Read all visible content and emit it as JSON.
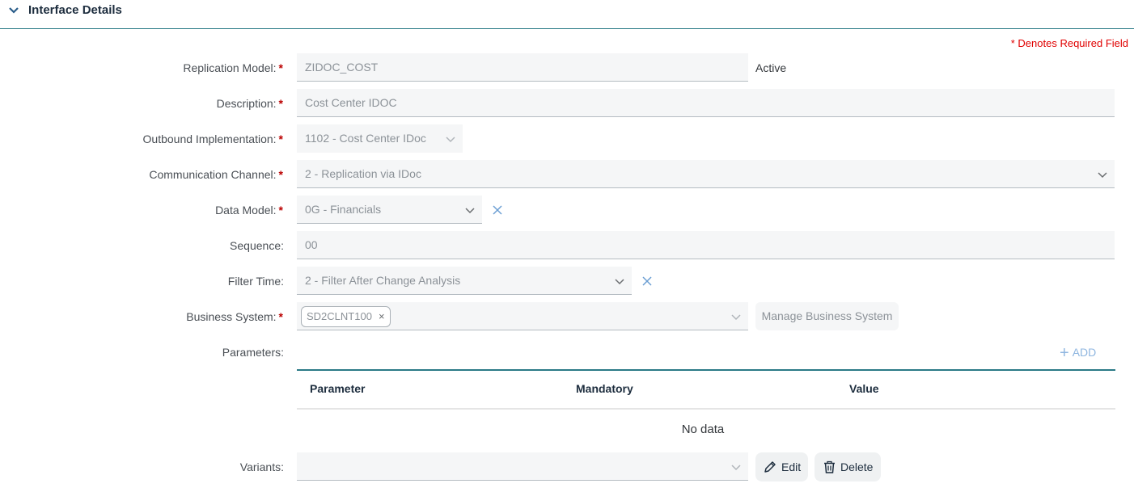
{
  "section": {
    "title": "Interface Details",
    "required_note": "* Denotes Required Field"
  },
  "fields": {
    "replication_model": {
      "label": "Replication Model:",
      "value": "ZIDOC_COST",
      "status": "Active"
    },
    "description": {
      "label": "Description:",
      "value": "Cost Center IDOC"
    },
    "outbound_implementation": {
      "label": "Outbound Implementation:",
      "value": "1102 - Cost Center IDoc"
    },
    "communication_channel": {
      "label": "Communication Channel:",
      "value": "2 - Replication via IDoc"
    },
    "data_model": {
      "label": "Data Model:",
      "value": "0G - Financials"
    },
    "sequence": {
      "label": "Sequence:",
      "value": "00"
    },
    "filter_time": {
      "label": "Filter Time:",
      "value": "2 - Filter After Change Analysis"
    },
    "business_system": {
      "label": "Business System:",
      "token": "SD2CLNT100",
      "manage_label": "Manage Business System"
    },
    "parameters": {
      "label": "Parameters:",
      "add_label": "ADD"
    },
    "variants": {
      "label": "Variants:",
      "value": "",
      "edit_label": "Edit",
      "delete_label": "Delete"
    }
  },
  "parameters_table": {
    "columns": [
      "Parameter",
      "Mandatory",
      "Value"
    ],
    "empty_text": "No data"
  },
  "colors": {
    "accent": "#2a7a86",
    "required": "#bb0000",
    "link": "#8fb6e0"
  }
}
